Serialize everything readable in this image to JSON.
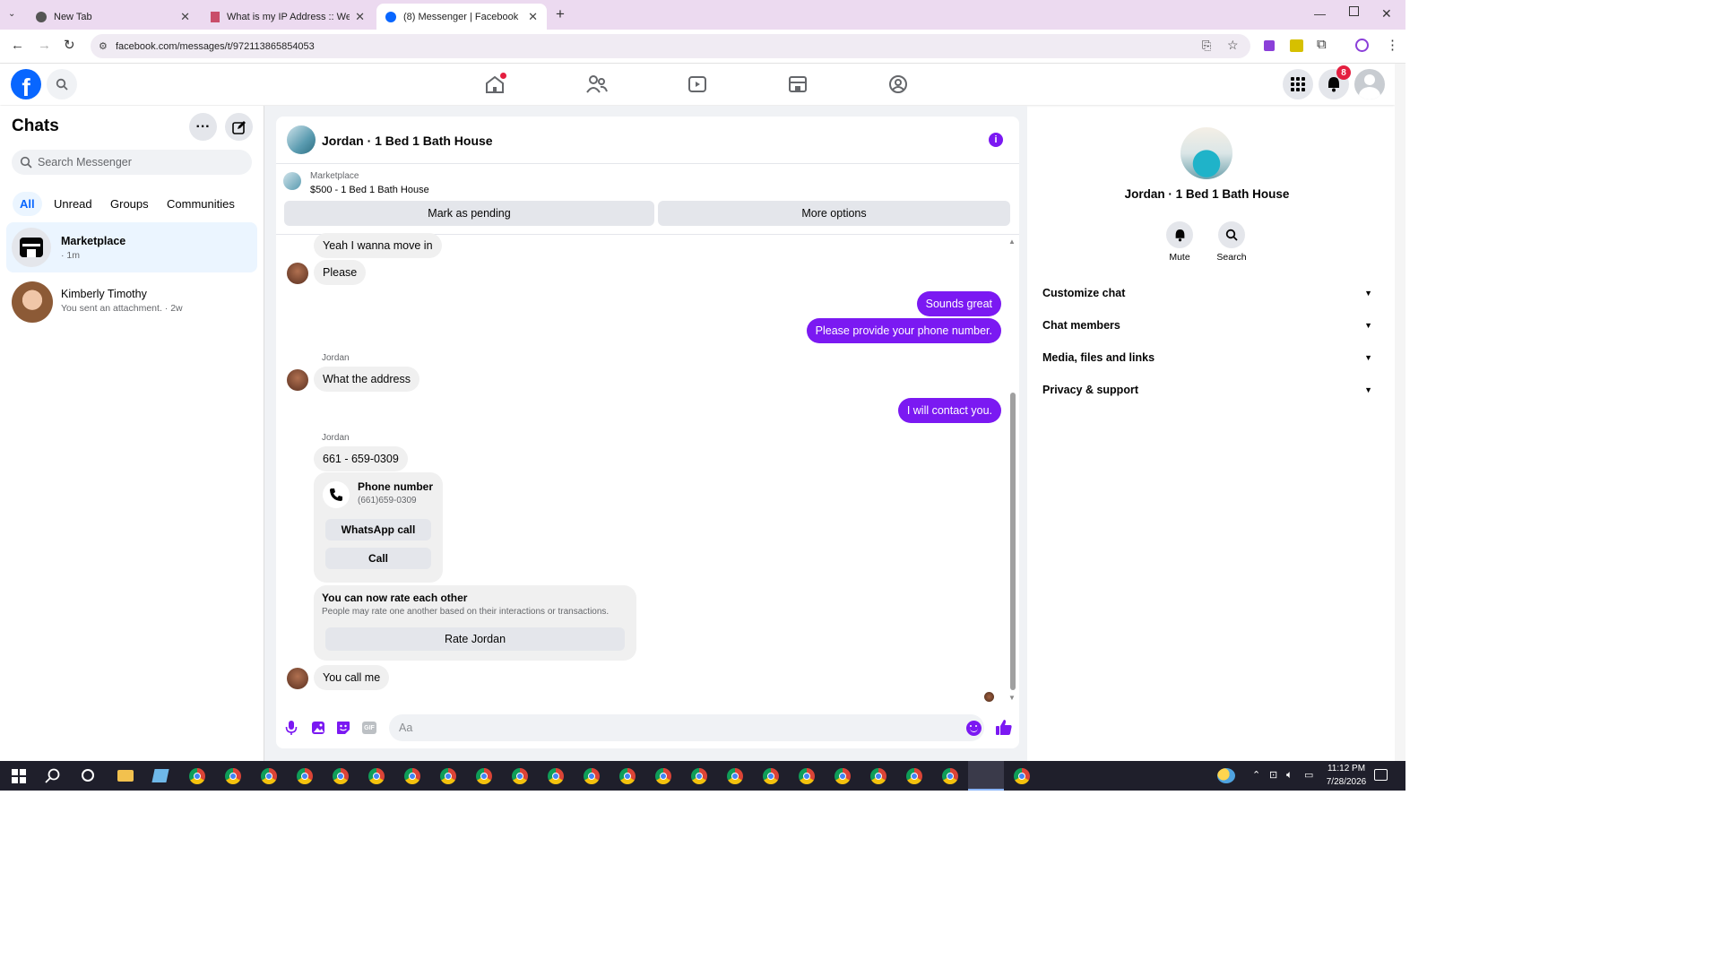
{
  "browser": {
    "tabs": [
      {
        "title": "New Tab"
      },
      {
        "title": "What is my IP Address :: WebBr"
      },
      {
        "title": "(8) Messenger | Facebook"
      }
    ],
    "url": "facebook.com/messages/t/972113865854053"
  },
  "fb": {
    "notification_count": "8"
  },
  "sidebar": {
    "title": "Chats",
    "search_placeholder": "Search Messenger",
    "filters": [
      "All",
      "Unread",
      "Groups",
      "Communities"
    ],
    "chats": [
      {
        "name": "Marketplace",
        "preview": "· 1m"
      },
      {
        "name": "Kimberly Timothy",
        "preview": "You sent an attachment. · 2w"
      }
    ]
  },
  "conversation": {
    "title": "Jordan · 1 Bed 1 Bath House",
    "listing_source": "Marketplace",
    "listing_title": "$500 - 1 Bed 1 Bath House",
    "mark_pending": "Mark as pending",
    "more_options": "More options",
    "messages": {
      "m1": "Yeah I wanna move in",
      "m2": "Please",
      "m3": "Sounds great",
      "m4": "Please provide your phone number.",
      "sender1": "Jordan",
      "m5": "What the address",
      "m6": "I will contact you.",
      "sender2": "Jordan",
      "m7": "661 - 659-0309",
      "phone_title": "Phone number",
      "phone_value": "(661)659-0309",
      "whatsapp": "WhatsApp call",
      "call": "Call",
      "rate_title": "You can now rate each other",
      "rate_sub": "People may rate one another based on their interactions or transactions.",
      "rate_btn": "Rate Jordan",
      "m8": "You call me"
    },
    "composer_placeholder": "Aa"
  },
  "details": {
    "name": "Jordan · 1 Bed 1 Bath House",
    "mute": "Mute",
    "search": "Search",
    "sections": [
      "Customize chat",
      "Chat members",
      "Media, files and links",
      "Privacy & support"
    ]
  },
  "taskbar": {
    "time": "11:12 PM",
    "date": "7/28/2026"
  },
  "colors": {
    "accent": "#7b19f2",
    "fb_blue": "#0866ff"
  }
}
